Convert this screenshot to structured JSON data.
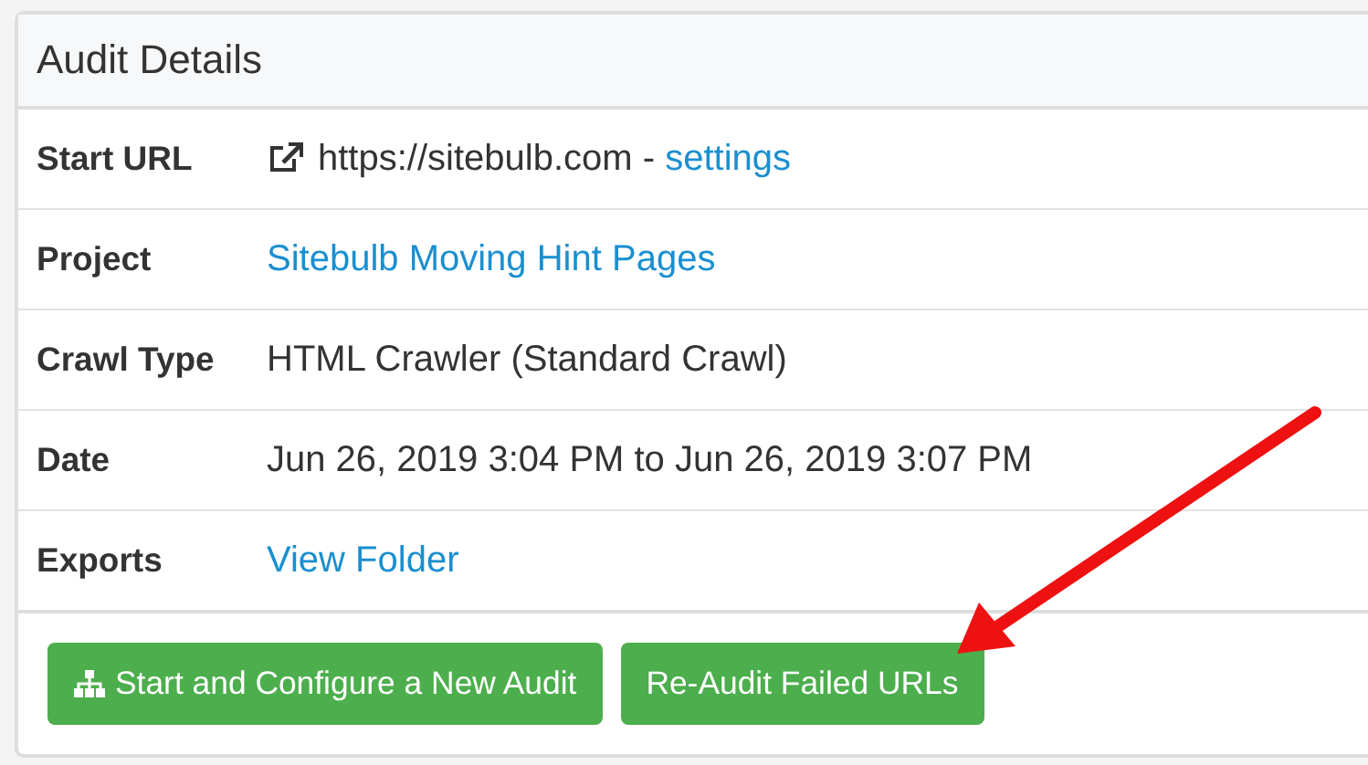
{
  "panel": {
    "title": "Audit Details",
    "rows": [
      {
        "label": "Start URL",
        "kind": "url",
        "value": [
          {
            "text": "https://sitebulb.com - ",
            "link": false
          },
          {
            "text": "settings",
            "link": true
          }
        ]
      },
      {
        "label": "Project",
        "value": [
          {
            "text": "Sitebulb Moving Hint Pages",
            "link": true
          }
        ]
      },
      {
        "label": "Crawl Type",
        "value": [
          {
            "text": "HTML Crawler (Standard Crawl)",
            "link": false
          }
        ]
      },
      {
        "label": "Date",
        "value": [
          {
            "text": "Jun 26, 2019 3:04 PM to Jun 26, 2019 3:07 PM",
            "link": false
          }
        ]
      },
      {
        "label": "Exports",
        "value": [
          {
            "text": "View Folder",
            "link": true
          }
        ]
      }
    ],
    "buttons": [
      {
        "label": "Start and Configure a New Audit",
        "kind": "tree"
      },
      {
        "label": "Re-Audit Failed URLs",
        "kind": "plain"
      }
    ]
  }
}
